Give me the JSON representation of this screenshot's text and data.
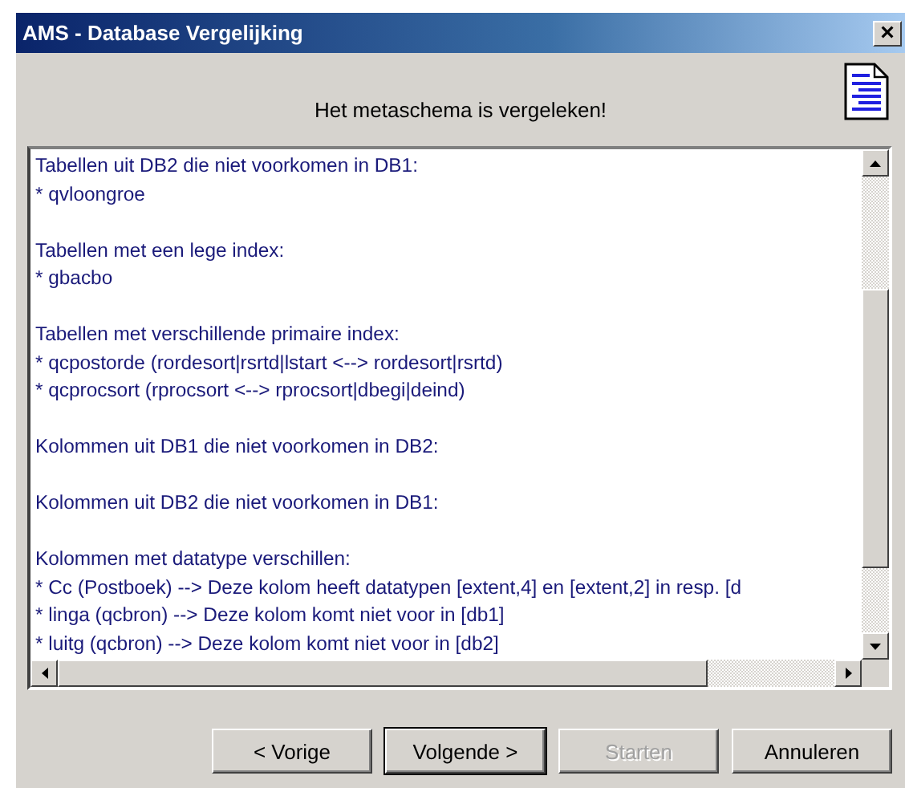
{
  "window": {
    "title": "AMS - Database Vergelijking",
    "close": "×"
  },
  "header": {
    "message": "Het metaschema is vergeleken!"
  },
  "report": {
    "sections": [
      {
        "heading": "Tabellen uit DB2 die niet voorkomen in DB1:",
        "items": [
          "* qvloongroe"
        ]
      },
      {
        "heading": "Tabellen met een lege index:",
        "items": [
          "* gbacbo"
        ]
      },
      {
        "heading": "Tabellen met verschillende primaire index:",
        "items": [
          "* qcpostorde (rordesort|rsrtd|lstart <--> rordesort|rsrtd)",
          "* qcprocsort (rprocsort <--> rprocsort|dbegi|deind)"
        ]
      },
      {
        "heading": "Kolommen uit DB1 die niet voorkomen in DB2:"
      },
      {
        "heading": "Kolommen uit DB2 die niet voorkomen in DB1:"
      },
      {
        "heading": "Kolommen met datatype verschillen:",
        "items": [
          "* Cc (Postboek) --> Deze kolom heeft datatypen [extent,4] en [extent,2] in resp. [d",
          "* linga (qcbron) --> Deze kolom komt niet voor in [db1]",
          "* luitg (qcbron) --> Deze kolom komt niet voor in [db2]"
        ]
      }
    ]
  },
  "buttons": [
    {
      "label": "< Vorige",
      "disabled": false,
      "default": false
    },
    {
      "label": "Volgende >",
      "disabled": false,
      "default": true
    },
    {
      "label": "Starten",
      "disabled": true,
      "default": false
    },
    {
      "label": "Annuleren",
      "disabled": false,
      "default": false
    }
  ]
}
